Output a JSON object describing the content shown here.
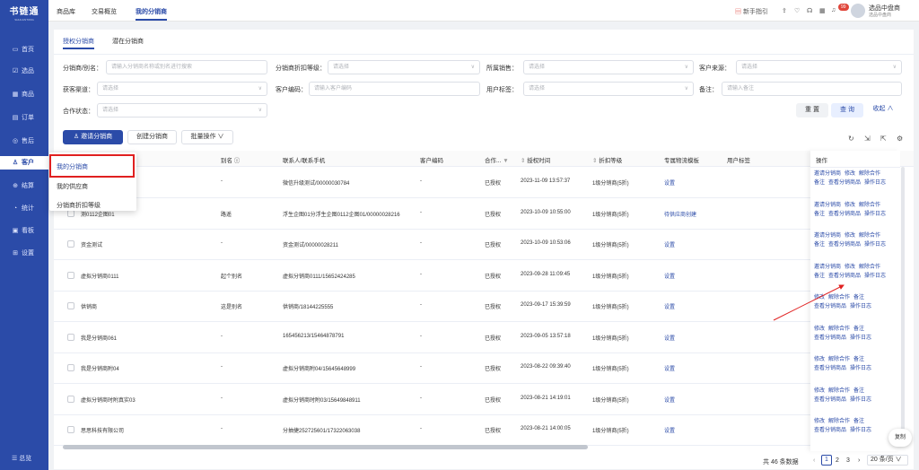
{
  "sidebar": {
    "logo": "书链通",
    "logo_sub": "SHULIANTONG",
    "items": [
      {
        "icon": "monitor-icon",
        "glyph": "▭",
        "label": "首页"
      },
      {
        "icon": "select-icon",
        "glyph": "☑",
        "label": "选品"
      },
      {
        "icon": "goods-icon",
        "glyph": "▦",
        "label": "商品"
      },
      {
        "icon": "order-icon",
        "glyph": "▤",
        "label": "订单"
      },
      {
        "icon": "aftersale-icon",
        "glyph": "◎",
        "label": "售后"
      },
      {
        "icon": "customer-icon",
        "glyph": "♙",
        "label": "客户"
      },
      {
        "icon": "settle-icon",
        "glyph": "⊕",
        "label": "结算"
      },
      {
        "icon": "stats-icon",
        "glyph": "◔",
        "label": "统计"
      },
      {
        "icon": "dashboard-icon",
        "glyph": "▣",
        "label": "看板"
      },
      {
        "icon": "settings-icon",
        "glyph": "⊞",
        "label": "设置"
      }
    ],
    "footer": "总览"
  },
  "topbar": {
    "tabs": [
      "商品库",
      "交易概览",
      "我的分销商"
    ],
    "guide": "新手指引",
    "badge": "99",
    "user_name": "选品中盘商",
    "user_role": "选品中盘商"
  },
  "subtabs": [
    "授权分销商",
    "潜在分销商"
  ],
  "filters": {
    "distributor": {
      "label": "分销商/别名：",
      "placeholder": "请输入分销商名称或别名进行搜索"
    },
    "discount_level": {
      "label": "分销商折扣等级：",
      "placeholder": "请选择"
    },
    "sales": {
      "label": "所属销售：",
      "placeholder": "请选择"
    },
    "source": {
      "label": "客户来源：",
      "placeholder": "请选择"
    },
    "channel": {
      "label": "获客渠道：",
      "placeholder": "请选择"
    },
    "customer_code": {
      "label": "客户编码：",
      "placeholder": "请输入客户编码"
    },
    "user_tag": {
      "label": "用户标签：",
      "placeholder": "请选择"
    },
    "remark": {
      "label": "备注：",
      "placeholder": "请输入备注"
    },
    "coop_status": {
      "label": "合作状态：",
      "placeholder": "请选择"
    }
  },
  "actions": {
    "reset": "重 置",
    "query": "查 询",
    "collapse": "收起 ∧",
    "invite": "邀请分销商",
    "create": "创建分销商",
    "batch": "批量操作 ∨"
  },
  "columns": [
    "别名",
    "联系人/联系手机",
    "客户编码",
    "合作...",
    "授权时间",
    "折扣等级",
    "专属物流模板",
    "用户标签",
    "操作"
  ],
  "dropdown": [
    "我的分销商",
    "我的供应商",
    "分销商折扣等级"
  ],
  "rows": [
    {
      "name": "",
      "alias": "-",
      "contact": "微信升级测试/00000030784",
      "code": "-",
      "status": "已授权",
      "time": "2023-11-09 13:57:37",
      "level": "1级分销商(5折)",
      "template": "设置",
      "ops": [
        "邀请分销商",
        "修改",
        "解除合作",
        "备注",
        "查看分销商品",
        "操作日志"
      ]
    },
    {
      "name": "测0112企图01",
      "alias": "路遥",
      "contact": "浮生企图01分浮生企图0112企图01/00000028216",
      "code": "-",
      "status": "已授权",
      "time": "2023-10-09 10:55:00",
      "level": "1级分销商(5折)",
      "template": "待供应商创建",
      "ops": [
        "邀请分销商",
        "修改",
        "解除合作",
        "备注",
        "查看分销商品",
        "操作日志"
      ]
    },
    {
      "name": "资金测试",
      "alias": "-",
      "contact": "资金测试/00000028211",
      "code": "-",
      "status": "已授权",
      "time": "2023-10-09 10:53:06",
      "level": "1级分销商(5折)",
      "template": "设置",
      "ops": [
        "邀请分销商",
        "修改",
        "解除合作",
        "备注",
        "查看分销商品",
        "操作日志"
      ]
    },
    {
      "name": "虚拟分销商0111",
      "alias": "起个别名",
      "contact": "虚拟分销商0111/15652424285",
      "code": "-",
      "status": "已授权",
      "time": "2023-09-28 11:09:45",
      "level": "1级分销商(5折)",
      "template": "设置",
      "ops": [
        "邀请分销商",
        "修改",
        "解除合作",
        "备注",
        "查看分销商品",
        "操作日志"
      ]
    },
    {
      "name": "供销商",
      "alias": "这是别名",
      "contact": "供销商/18144225555",
      "code": "-",
      "status": "已授权",
      "time": "2023-09-17 15:39:59",
      "level": "1级分销商(5折)",
      "template": "设置",
      "ops": [
        "修改",
        "解除合作",
        "备注",
        "查看分销商品",
        "操作日志"
      ]
    },
    {
      "name": "我是分销商061",
      "alias": "-",
      "contact": "165456213/15464878791",
      "code": "-",
      "status": "已授权",
      "time": "2023-09-05 13:57:18",
      "level": "1级分销商(5折)",
      "template": "设置",
      "ops": [
        "修改",
        "解除合作",
        "备注",
        "查看分销商品",
        "操作日志"
      ]
    },
    {
      "name": "我是分销商附04",
      "alias": "-",
      "contact": "虚拟分销商附04/15645648999",
      "code": "-",
      "status": "已授权",
      "time": "2023-08-22 09:39:40",
      "level": "1级分销商(5折)",
      "template": "设置",
      "ops": [
        "修改",
        "解除合作",
        "备注",
        "查看分销商品",
        "操作日志"
      ]
    },
    {
      "name": "虚拟分销商时附真实03",
      "alias": "-",
      "contact": "虚拟分销商时附03/15649848911",
      "code": "-",
      "status": "已授权",
      "time": "2023-08-21 14:19:01",
      "level": "1级分销商(5折)",
      "template": "设置",
      "ops": [
        "修改",
        "解除合作",
        "备注",
        "查看分销商品",
        "操作日志"
      ]
    },
    {
      "name": "思思科技有限公司",
      "alias": "-",
      "contact": "分抽捷252725601/17322063038",
      "code": "-",
      "status": "已授权",
      "time": "2023-08-21 14:00:05",
      "level": "1级分销商(5折)",
      "template": "设置",
      "ops": [
        "修改",
        "解除合作",
        "备注",
        "查看分销商品",
        "操作日志"
      ]
    }
  ],
  "pager": {
    "total": "共 46 条数据",
    "pages": [
      "1",
      "2",
      "3"
    ],
    "size": "20 条/页"
  },
  "copy": "复制"
}
